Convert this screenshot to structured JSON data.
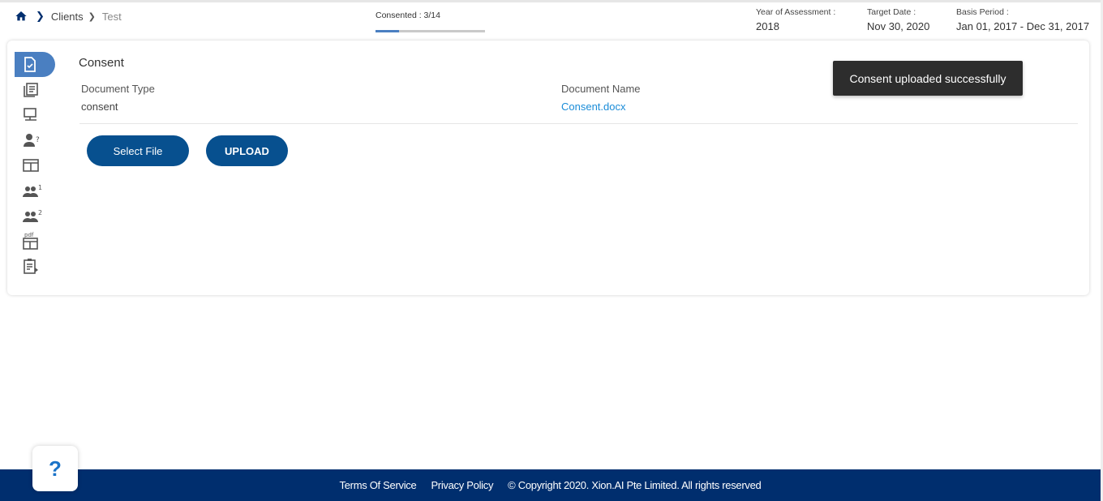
{
  "breadcrumb": {
    "clients": "Clients",
    "current": "Test"
  },
  "progress": {
    "label": "Consented : 3/14",
    "fraction": 0.214
  },
  "meta": {
    "year_label": "Year of Assessment :",
    "year_value": "2018",
    "target_label": "Target Date :",
    "target_value": "Nov 30, 2020",
    "basis_label": "Basis Period :",
    "basis_value": "Jan 01, 2017 - Dec 31, 2017"
  },
  "card": {
    "title": "Consent",
    "doc_type_header": "Document Type",
    "doc_type_value": "consent",
    "doc_name_header": "Document Name",
    "doc_name_value": "Consent.docx",
    "select_label": "Select File",
    "upload_label": "UPLOAD"
  },
  "sidebar": {
    "items": [
      {
        "icon": "consent-document-icon",
        "active": true
      },
      {
        "icon": "library-books-icon",
        "active": false
      },
      {
        "icon": "computer-network-icon",
        "active": false
      },
      {
        "icon": "person-question-icon",
        "active": false
      },
      {
        "icon": "web-layout-icon",
        "active": false
      },
      {
        "icon": "people-one-icon",
        "active": false
      },
      {
        "icon": "people-two-icon",
        "active": false
      },
      {
        "icon": "pdf-layout-icon",
        "active": false
      },
      {
        "icon": "clipboard-play-icon",
        "active": false
      }
    ]
  },
  "toast": {
    "message": "Consent uploaded successfully"
  },
  "help": {
    "label": "?"
  },
  "footer": {
    "terms": "Terms Of Service",
    "privacy": "Privacy Policy",
    "copyright": "© Copyright 2020. Xion.AI Pte Limited. All rights reserved"
  },
  "colors": {
    "primary": "#07508f",
    "accent": "#4a7fc1",
    "footer": "#002e6e",
    "link": "#1a8cd8"
  }
}
